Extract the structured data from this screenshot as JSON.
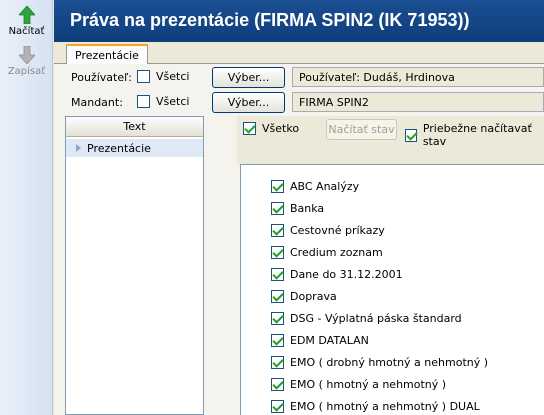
{
  "toolbar": {
    "load_label": "Načítať",
    "save_label": "Zapísať"
  },
  "window": {
    "title": "Práva na prezentácie (FIRMA SPIN2 (IK 71953))"
  },
  "tabs": [
    {
      "label": "Prezentácie"
    }
  ],
  "filters": {
    "user_label": "Používateľ:",
    "user_all_label": "Všetci",
    "user_all_checked": false,
    "user_select_label": "Výber...",
    "user_value": "Používateľ: Dudáš, Hrdinova",
    "mandant_label": "Mandant:",
    "mandant_all_label": "Všetci",
    "mandant_all_checked": false,
    "mandant_select_label": "Výber...",
    "mandant_value": "FIRMA SPIN2"
  },
  "tree": {
    "header": "Text",
    "items": [
      {
        "label": "Prezentácie"
      }
    ]
  },
  "right": {
    "all_label": "Všetko",
    "all_checked": true,
    "load_state_label": "Načítať stav",
    "continuous_label": "Priebežne načítavať stav",
    "continuous_checked": true
  },
  "presentations": [
    {
      "label": "ABC Analýzy",
      "checked": true
    },
    {
      "label": "Banka",
      "checked": true
    },
    {
      "label": "Cestovné príkazy",
      "checked": true
    },
    {
      "label": "Credium zoznam",
      "checked": true
    },
    {
      "label": "Dane do 31.12.2001",
      "checked": true
    },
    {
      "label": "Doprava",
      "checked": true
    },
    {
      "label": "DSG - Výplatná páska štandard",
      "checked": true
    },
    {
      "label": "EDM DATALAN",
      "checked": true
    },
    {
      "label": "EMO ( drobný hmotný a nehmotný )",
      "checked": true
    },
    {
      "label": "EMO ( hmotný a nehmotný )",
      "checked": true
    },
    {
      "label": "EMO ( hmotný a nehmotný ) DUAL",
      "checked": true
    }
  ],
  "colors": {
    "title_bg": "#1a4f93",
    "title_text": "#ffffff",
    "arrow_green": "#2fa63a",
    "tab_accent": "#f5a623"
  }
}
